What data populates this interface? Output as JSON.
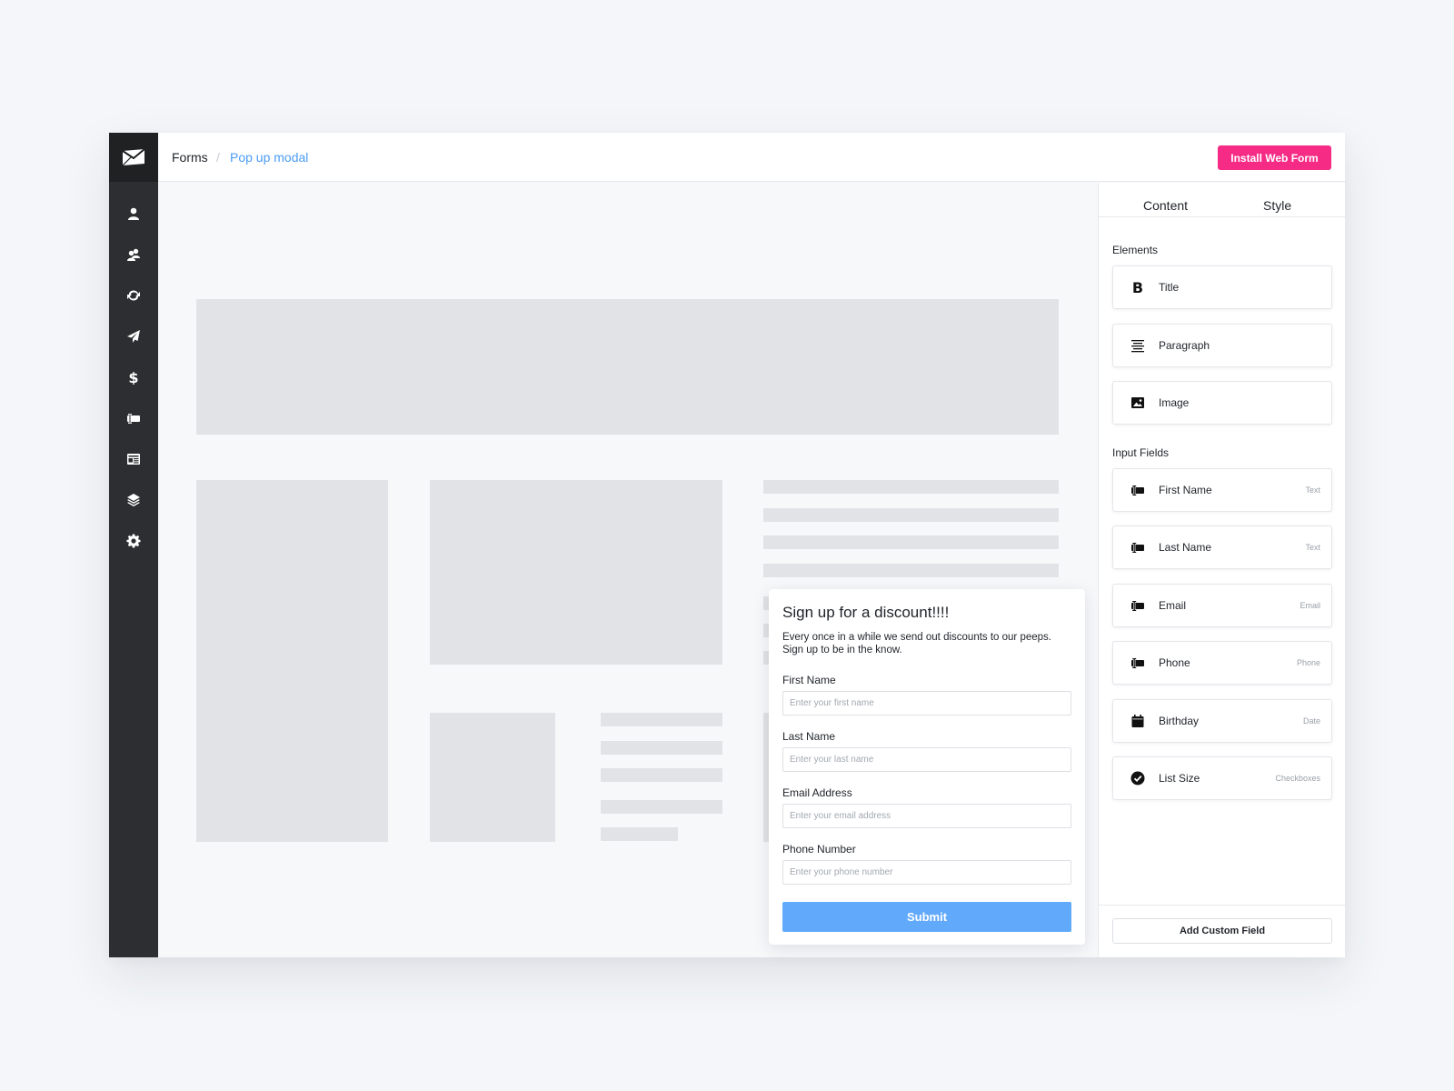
{
  "app": {
    "logo_icon": "envelope-logo-icon",
    "nav_items": [
      {
        "icon": "user-icon"
      },
      {
        "icon": "users-icon"
      },
      {
        "icon": "sync-icon"
      },
      {
        "icon": "paper-plane-icon"
      },
      {
        "icon": "dollar-icon"
      },
      {
        "icon": "form-field-icon"
      },
      {
        "icon": "newspaper-icon"
      },
      {
        "icon": "layers-icon"
      },
      {
        "icon": "gear-icon"
      }
    ]
  },
  "breadcrumb": {
    "root": "Forms",
    "separator": "/",
    "current": "Pop up modal"
  },
  "header": {
    "install_label": "Install Web Form"
  },
  "panel": {
    "tabs": [
      {
        "label": "Content"
      },
      {
        "label": "Style"
      }
    ],
    "elements_heading": "Elements",
    "elements": [
      {
        "label": "Title",
        "icon": "bold-icon"
      },
      {
        "label": "Paragraph",
        "icon": "align-center-icon"
      },
      {
        "label": "Image",
        "icon": "image-icon"
      }
    ],
    "inputs_heading": "Input Fields",
    "input_fields": [
      {
        "label": "First Name",
        "type": "Text",
        "icon": "form-field-icon"
      },
      {
        "label": "Last Name",
        "type": "Text",
        "icon": "form-field-icon"
      },
      {
        "label": "Email",
        "type": "Email",
        "icon": "form-field-icon"
      },
      {
        "label": "Phone",
        "type": "Phone",
        "icon": "form-field-icon"
      },
      {
        "label": "Birthday",
        "type": "Date",
        "icon": "calendar-icon"
      },
      {
        "label": "List Size",
        "type": "Checkboxes",
        "icon": "check-circle-icon"
      }
    ],
    "add_custom_label": "Add Custom Field"
  },
  "modal": {
    "title": "Sign up for a discount!!!!",
    "description": "Every once in a while we send out discounts to our peeps. Sign up to be in the know.",
    "fields": [
      {
        "label": "First Name",
        "placeholder": "Enter your first name"
      },
      {
        "label": "Last Name",
        "placeholder": "Enter your last name"
      },
      {
        "label": "Email Address",
        "placeholder": "Enter your email address"
      },
      {
        "label": "Phone Number",
        "placeholder": "Enter your phone number"
      }
    ],
    "submit_label": "Submit"
  },
  "colors": {
    "sidebar_bg": "#2c2e31",
    "accent_pink": "#f62b86",
    "breadcrumb_link": "#4a9cf5",
    "submit_blue": "#61a9fb",
    "placeholder_gray": "#e1e3e6"
  }
}
